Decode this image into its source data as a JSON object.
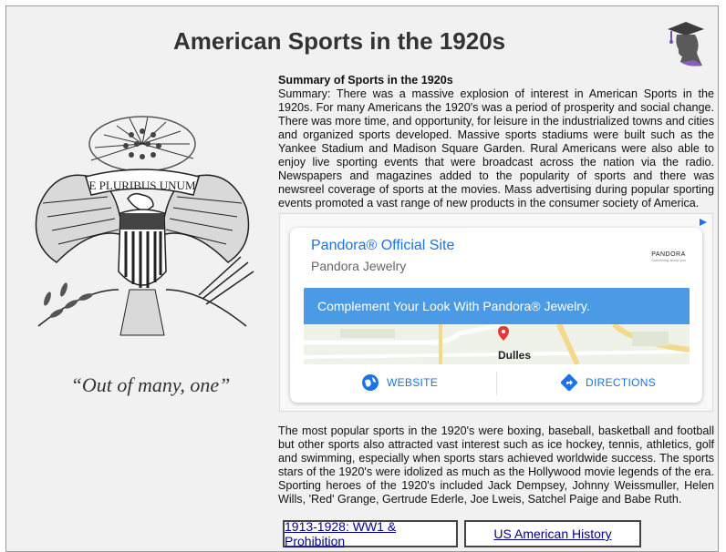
{
  "page": {
    "title": "American Sports in the 1920s",
    "motto": "“Out of many, one”",
    "seal_text": "E PLURIBUS UNUM"
  },
  "summary": {
    "heading": "Summary of Sports in the 1920s",
    "text": "Summary: There was a massive explosion of interest in American Sports in the 1920s. For many Americans the 1920's was a period of prosperity and social change. There was more time, and opportunity, for leisure in the industrialized towns and cities and organized sports developed. Massive sports stadiums were built such as the Yankee Stadium and Madison Square Garden. Rural Americans were also able to enjoy live sporting events that were broadcast across the nation via the radio. Newspapers and magazines added to the popularity of sports and there was newsreel coverage of sports at the movies. Mass advertising during popular sporting events promoted a vast range of new products in the consumer society of America."
  },
  "ad": {
    "title": "Pandora® Official Site",
    "subtitle": "Pandora Jewelry",
    "brand": "PANDORA",
    "brand_tagline": "Something about you",
    "banner": "Complement Your Look With Pandora® Jewelry.",
    "map_label": "Dulles",
    "website_label": "WEBSITE",
    "directions_label": "DIRECTIONS",
    "accent_color": "#1a73e8",
    "banner_color": "#4a9ae6"
  },
  "content": {
    "paragraph2": "The most popular sports in the 1920's were boxing, baseball, basketball and football but other sports also attracted vast interest such as ice hockey, tennis, athletics, golf and swimming, especially when sports stars achieved worldwide success. The sports stars of the 1920's were idolized as much as the Hollywood movie legends of the era. Sporting heroes of the 1920's included Jack Dempsey, Johnny Weissmuller, Helen Wills, 'Red' Grange, Gertrude Ederle, Joe Lweis, Satchel Paige and Babe Ruth."
  },
  "nav": {
    "prev_label": "1913-1928: WW1 & Prohibition",
    "history_label": "US American History"
  }
}
